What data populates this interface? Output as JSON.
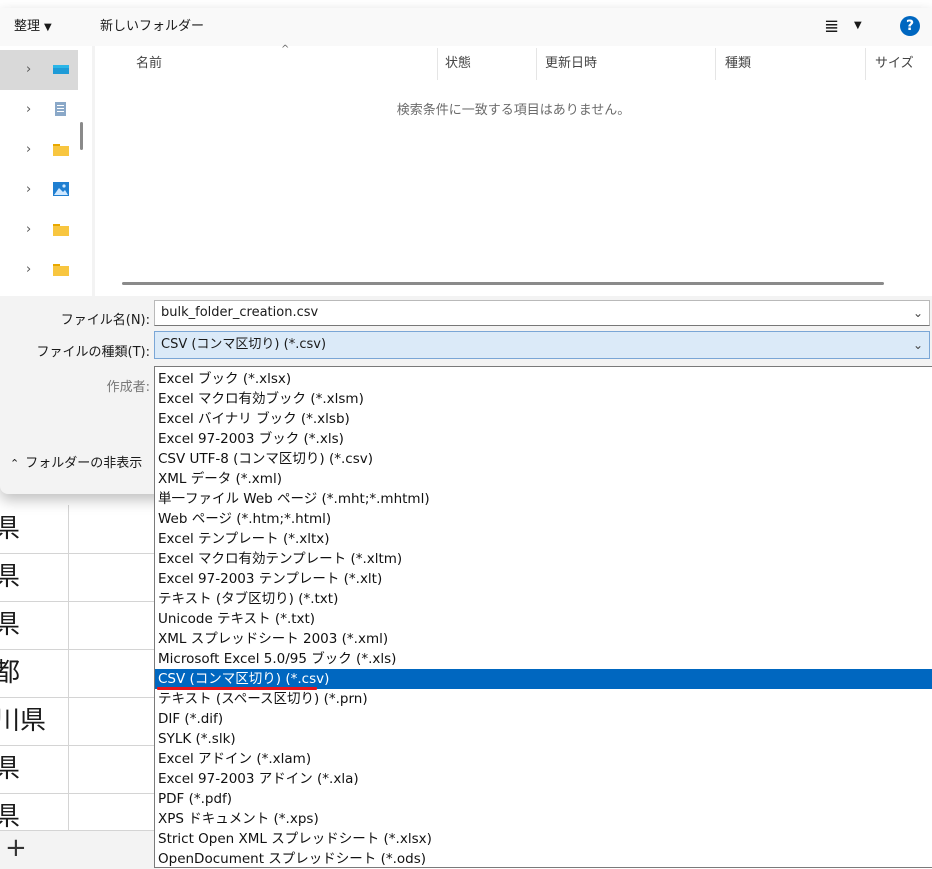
{
  "toolbar": {
    "organize_label": "整理",
    "new_folder_label": "新しいフォルダー",
    "view_icon": "≣",
    "help_label": "?"
  },
  "nav": {
    "icons": [
      "onedrive-icon",
      "document-icon",
      "folder-icon",
      "pictures-icon",
      "folder-icon",
      "folder-icon"
    ]
  },
  "file_list": {
    "columns": [
      "名前",
      "状態",
      "更新日時",
      "種類",
      "サイズ"
    ],
    "empty_message": "検索条件に一致する項目はありません。"
  },
  "fields": {
    "filename_label": "ファイル名(N):",
    "filename_value": "bulk_folder_creation.csv",
    "filetype_label": "ファイルの種類(T):",
    "filetype_value": "CSV (コンマ区切り) (*.csv)",
    "author_label": "作成者:"
  },
  "hide_folders_label": "フォルダーの非表示",
  "dropdown_options": [
    "Excel ブック (*.xlsx)",
    "Excel マクロ有効ブック (*.xlsm)",
    "Excel バイナリ ブック (*.xlsb)",
    "Excel 97-2003 ブック (*.xls)",
    "CSV UTF-8 (コンマ区切り) (*.csv)",
    "XML データ (*.xml)",
    "単一ファイル Web ページ (*.mht;*.mhtml)",
    "Web ページ (*.htm;*.html)",
    "Excel テンプレート (*.xltx)",
    "Excel マクロ有効テンプレート (*.xltm)",
    "Excel 97-2003 テンプレート (*.xlt)",
    "テキスト (タブ区切り) (*.txt)",
    "Unicode テキスト (*.txt)",
    "XML スプレッドシート 2003 (*.xml)",
    "Microsoft Excel 5.0/95 ブック (*.xls)",
    "CSV (コンマ区切り) (*.csv)",
    "テキスト (スペース区切り) (*.prn)",
    "DIF (*.dif)",
    "SYLK (*.slk)",
    "Excel アドイン (*.xlam)",
    "Excel 97-2003 アドイン (*.xla)",
    "PDF (*.pdf)",
    "XPS ドキュメント (*.xps)",
    "Strict Open XML スプレッドシート (*.xlsx)",
    "OpenDocument スプレッドシート (*.ods)"
  ],
  "selected_option_index": 15,
  "sheet_cells": [
    "県",
    "県",
    "県",
    "都",
    "川県",
    "県",
    "県"
  ],
  "add_sheet_label": "+",
  "colors": {
    "accent": "#0067c0",
    "highlight_underline": "#e8141b"
  }
}
